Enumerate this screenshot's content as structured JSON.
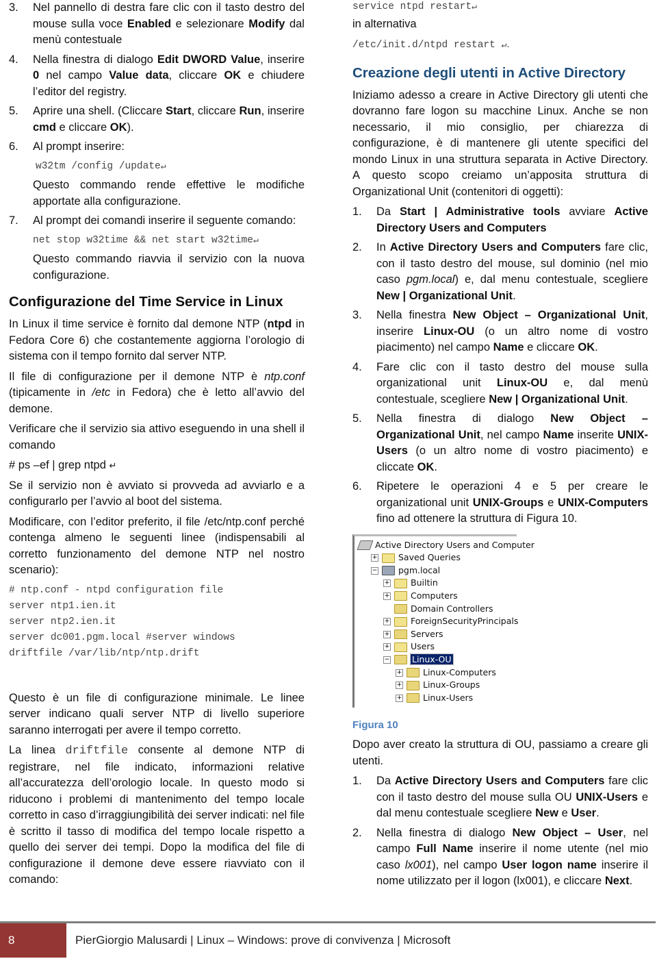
{
  "left_column": {
    "steps_a": [
      {
        "num": "3.",
        "parts": [
          [
            "t",
            "Nel pannello di destra fare clic con il tasto destro del mouse sulla voce "
          ],
          [
            "b",
            "Enabled"
          ],
          [
            "t",
            " e selezionare "
          ],
          [
            "b",
            "Modify"
          ],
          [
            "t",
            " dal menù contestuale"
          ]
        ]
      },
      {
        "num": "4.",
        "parts": [
          [
            "t",
            "Nella finestra di dialogo "
          ],
          [
            "b",
            "Edit DWORD Value"
          ],
          [
            "t",
            ", inserire "
          ],
          [
            "b",
            "0"
          ],
          [
            "t",
            " nel campo "
          ],
          [
            "b",
            "Value data"
          ],
          [
            "t",
            ", cliccare "
          ],
          [
            "b",
            "OK"
          ],
          [
            "t",
            " e chiudere l’editor del registry."
          ]
        ]
      },
      {
        "num": "5.",
        "parts": [
          [
            "t",
            "Aprire una shell. (Cliccare "
          ],
          [
            "b",
            "Start"
          ],
          [
            "t",
            ", cliccare  "
          ],
          [
            "b",
            "Run"
          ],
          [
            "t",
            ", inserire "
          ],
          [
            "b",
            "cmd"
          ],
          [
            "t",
            " e cliccare "
          ],
          [
            "b",
            "OK"
          ],
          [
            "t",
            ")."
          ]
        ]
      }
    ],
    "step6": {
      "num": "6.",
      "text": "Al prompt inserire:",
      "command": "w32tm /config /update",
      "note": "Questo commando rende effettive le modifiche apportate alla configurazione."
    },
    "step7": {
      "num": "7.",
      "text": "Al prompt dei comandi inserire il seguente comando:",
      "command": "net stop w32time && net start w32time",
      "note": "Questo commando riavvia il servizio con la nuova configurazione."
    },
    "heading": "Configurazione del Time Service in Linux",
    "para1": [
      [
        "t",
        "In Linux il time service è fornito dal demone NTP ("
      ],
      [
        "b",
        "ntpd"
      ],
      [
        "t",
        " in Fedora Core 6) che costantemente aggiorna l’orologio di sistema con il tempo fornito dal server NTP."
      ]
    ],
    "para2": [
      [
        "t",
        "Il file di configurazione per il demone NTP è "
      ],
      [
        "i",
        "ntp.conf"
      ],
      [
        "t",
        " (tipicamente in "
      ],
      [
        "i",
        "/etc"
      ],
      [
        "t",
        " in Fedora) che è letto all’avvio del demone."
      ]
    ],
    "para3": "Verificare che il servizio sia attivo eseguendo in una shell il comando",
    "ps_command": "# ps –ef | grep ntpd",
    "para4": "Se il servizio non è avviato si provveda ad avviarlo e a configurarlo per l’avvio al boot del sistema.",
    "para5": "Modificare, con l’editor preferito, il file /etc/ntp.conf perché contenga almeno le seguenti linee (indispensabili al corretto funzionamento del demone NTP nel nostro scenario):",
    "config_lines": [
      "# ntp.conf - ntpd configuration file",
      "server ntp1.ien.it",
      "server ntp2.ien.it",
      "server dc001.pgm.local #server windows",
      "driftfile /var/lib/ntp/ntp.drift"
    ],
    "para6": "Questo è un file di configurazione minimale. Le linee server indicano quali server NTP di livello superiore saranno interrogati per avere il tempo corretto.",
    "para7_pre": "La linea ",
    "para7_code": "driftfile",
    "para7_post": " consente al demone NTP di registrare, nel file indicato,  informazioni relative all’accuratezza dell’orologio locale. In questo modo si riducono i problemi di mantenimento del tempo locale corretto in caso d’irraggiungibilità dei server indicati: nel file è scritto il tasso di modifica del tempo locale rispetto a quello dei server dei tempi. Dopo la modifica del file di configurazione il demone deve essere riavviato con il comando:"
  },
  "right_column": {
    "restart_cmd": "service ntpd restart",
    "alt_text": "in alternativa",
    "alt_cmd": "/etc/init.d/ntpd restart ",
    "heading": "Creazione degli utenti in Active Directory",
    "intro": "Iniziamo adesso a creare in Active Directory gli utenti che dovranno fare logon su macchine Linux. Anche se non necessario, il mio consiglio, per chiarezza di configurazione, è di mantenere gli utente specifici del mondo Linux in una struttura separata in Active Directory. A questo scopo creiamo un’apposita struttura di Organizational Unit (contenitori di oggetti):",
    "steps_ou": [
      {
        "num": "1.",
        "parts": [
          [
            "t",
            "Da "
          ],
          [
            "b",
            "Start | Administrative tools"
          ],
          [
            "t",
            " avviare "
          ],
          [
            "b",
            "Active Directory Users and Computers"
          ]
        ]
      },
      {
        "num": "2.",
        "parts": [
          [
            "t",
            "In "
          ],
          [
            "b",
            "Active Directory Users and Computers"
          ],
          [
            "t",
            " fare clic, con il tasto destro del mouse, sul dominio (nel mio caso "
          ],
          [
            "i",
            "pgm.local"
          ],
          [
            "t",
            ") e, dal menu contestuale, scegliere "
          ],
          [
            "b",
            "New | Organizational Unit"
          ],
          [
            "t",
            "."
          ]
        ]
      },
      {
        "num": "3.",
        "parts": [
          [
            "t",
            "Nella finestra "
          ],
          [
            "b",
            "New Object – Organizational Unit"
          ],
          [
            "t",
            ", inserire  "
          ],
          [
            "b",
            "Linux-OU"
          ],
          [
            "t",
            " (o un altro nome di vostro piacimento) nel campo  "
          ],
          [
            "b",
            "Name"
          ],
          [
            "t",
            " e cliccare "
          ],
          [
            "b",
            "OK"
          ],
          [
            "t",
            "."
          ]
        ]
      },
      {
        "num": "4.",
        "parts": [
          [
            "t",
            "Fare clic con il tasto destro del mouse sulla organizational unit "
          ],
          [
            "b",
            "Linux-OU"
          ],
          [
            "t",
            "  e, dal menù contestuale, scegliere "
          ],
          [
            "b",
            "New | Organizational Unit"
          ],
          [
            "t",
            "."
          ]
        ]
      },
      {
        "num": "5.",
        "parts": [
          [
            "t",
            "Nella finestra di dialogo "
          ],
          [
            "b",
            "New Object – Organizational Unit"
          ],
          [
            "t",
            ", nel campo "
          ],
          [
            "b",
            "Name"
          ],
          [
            "t",
            " inserite "
          ],
          [
            "b",
            "UNIX-Users"
          ],
          [
            "t",
            " (o un altro nome di vostro piacimento) e cliccate  "
          ],
          [
            "b",
            "OK"
          ],
          [
            "t",
            "."
          ]
        ]
      },
      {
        "num": "6.",
        "parts": [
          [
            "t",
            "Ripetere le operazioni 4 e 5 per creare le organizational unit "
          ],
          [
            "b",
            "UNIX-Groups"
          ],
          [
            "t",
            " e "
          ],
          [
            "b",
            "UNIX-Computers"
          ],
          [
            "t",
            " fino ad ottenere la struttura di Figura 10."
          ]
        ]
      }
    ],
    "figure": {
      "tree": [
        {
          "label": "Active Directory Users and Computer",
          "indent": 0,
          "toggle": "",
          "icon": "ad-root-icon"
        },
        {
          "label": "Saved Queries",
          "indent": 1,
          "toggle": "+",
          "icon": "folder-icon"
        },
        {
          "label": "pgm.local",
          "indent": 1,
          "toggle": "−",
          "icon": "domain-icon"
        },
        {
          "label": "Builtin",
          "indent": 2,
          "toggle": "+",
          "icon": "folder-icon"
        },
        {
          "label": "Computers",
          "indent": 2,
          "toggle": "+",
          "icon": "folder-icon"
        },
        {
          "label": "Domain Controllers",
          "indent": 2,
          "toggle": "",
          "icon": "ou-icon"
        },
        {
          "label": "ForeignSecurityPrincipals",
          "indent": 2,
          "toggle": "+",
          "icon": "folder-icon"
        },
        {
          "label": "Servers",
          "indent": 2,
          "toggle": "+",
          "icon": "ou-icon"
        },
        {
          "label": "Users",
          "indent": 2,
          "toggle": "+",
          "icon": "folder-icon"
        },
        {
          "label": "Linux-OU",
          "indent": 2,
          "toggle": "−",
          "icon": "ou-icon",
          "selected": true
        },
        {
          "label": "Linux-Computers",
          "indent": 3,
          "toggle": "+",
          "icon": "ou-icon"
        },
        {
          "label": "Linux-Groups",
          "indent": 3,
          "toggle": "+",
          "icon": "ou-icon"
        },
        {
          "label": "Linux-Users",
          "indent": 3,
          "toggle": "+",
          "icon": "ou-icon"
        }
      ],
      "caption": "Figura 10"
    },
    "after_figure": "Dopo aver creato la struttura di OU, passiamo a creare gli utenti.",
    "steps_user": [
      {
        "num": "1.",
        "parts": [
          [
            "t",
            "Da "
          ],
          [
            "b",
            "Active Directory Users and Computers"
          ],
          [
            "t",
            " fare clic con il tasto destro del mouse sulla OU "
          ],
          [
            "b",
            "UNIX-Users"
          ],
          [
            "t",
            " e dal menu contestuale scegliere "
          ],
          [
            "b",
            "New"
          ],
          [
            "t",
            " e "
          ],
          [
            "b",
            "User"
          ],
          [
            "t",
            "."
          ]
        ]
      },
      {
        "num": "2.",
        "parts": [
          [
            "t",
            "Nella finestra di dialogo "
          ],
          [
            "b",
            "New Object – User"
          ],
          [
            "t",
            ", nel campo "
          ],
          [
            "b",
            "Full Name"
          ],
          [
            "t",
            " inserire il nome utente (nel mio caso "
          ],
          [
            "i",
            "lx001"
          ],
          [
            "t",
            "), nel campo  "
          ],
          [
            "b",
            "User logon name"
          ],
          [
            "t",
            " inserire il nome utilizzato per il logon (lx001), e cliccare "
          ],
          [
            "b",
            "Next"
          ],
          [
            "t",
            "."
          ]
        ]
      }
    ]
  },
  "footer": {
    "page_number": "8",
    "text": "PierGiorgio Malusardi | Linux – Windows: prove di convivenza | Microsoft",
    "accent_color": "#943634"
  },
  "colors": {
    "heading_blue": "#1f4e79",
    "caption_blue": "#4f81bd",
    "selection": "#0a246a"
  }
}
